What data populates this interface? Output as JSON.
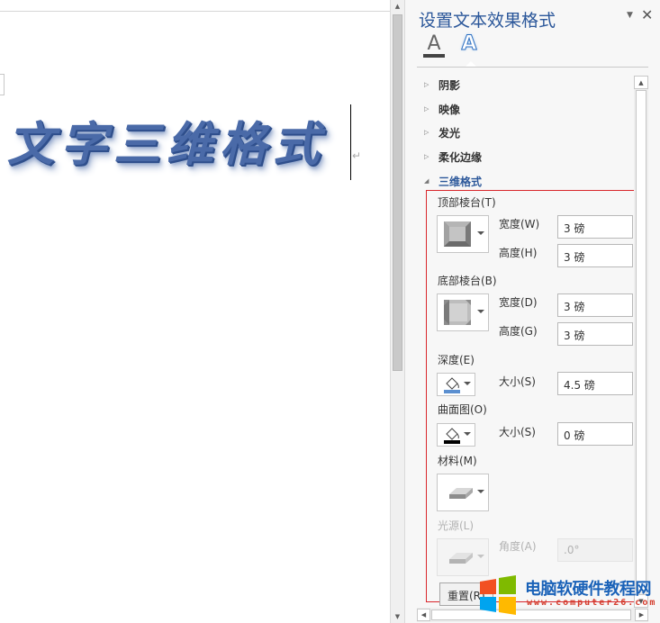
{
  "document": {
    "wordart_text": "文字三维格式",
    "paragraph_mark": "↵"
  },
  "pane": {
    "title": "设置文本效果格式",
    "dropdown_glyph": "▼",
    "close_glyph": "✕",
    "tabs": [
      {
        "name": "text-fill-outline",
        "glyph": "A"
      },
      {
        "name": "text-effects",
        "glyph": "A"
      }
    ],
    "sections": {
      "shadow": {
        "label": "阴影",
        "expanded": false
      },
      "reflection": {
        "label": "映像",
        "expanded": false
      },
      "glow": {
        "label": "发光",
        "expanded": false
      },
      "soft_edges": {
        "label": "柔化边缘",
        "expanded": false
      },
      "format_3d": {
        "label": "三维格式",
        "expanded": true
      }
    },
    "format_3d": {
      "top_bevel": {
        "label": "顶部棱台(T)",
        "width_label": "宽度(W)",
        "width_value": "3 磅",
        "height_label": "高度(H)",
        "height_value": "3 磅"
      },
      "bottom_bevel": {
        "label": "底部棱台(B)",
        "width_label": "宽度(D)",
        "width_value": "3 磅",
        "height_label": "高度(G)",
        "height_value": "3 磅"
      },
      "depth": {
        "label": "深度(E)",
        "size_label": "大小(S)",
        "size_value": "4.5 磅"
      },
      "contour": {
        "label": "曲面图(O)",
        "size_label": "大小(S)",
        "size_value": "0 磅"
      },
      "material": {
        "label": "材料(M)"
      },
      "lighting": {
        "label": "光源(L)",
        "angle_label": "角度(A)",
        "angle_value": ".0°",
        "disabled": true
      },
      "reset_label": "重置(R)"
    }
  },
  "watermark": {
    "title": "电脑软硬件教程网",
    "url": "www.computer26.com"
  },
  "colors": {
    "accent": "#2b579a",
    "highlight_border": "#d9262c",
    "wordart": "#4a6aa8"
  }
}
